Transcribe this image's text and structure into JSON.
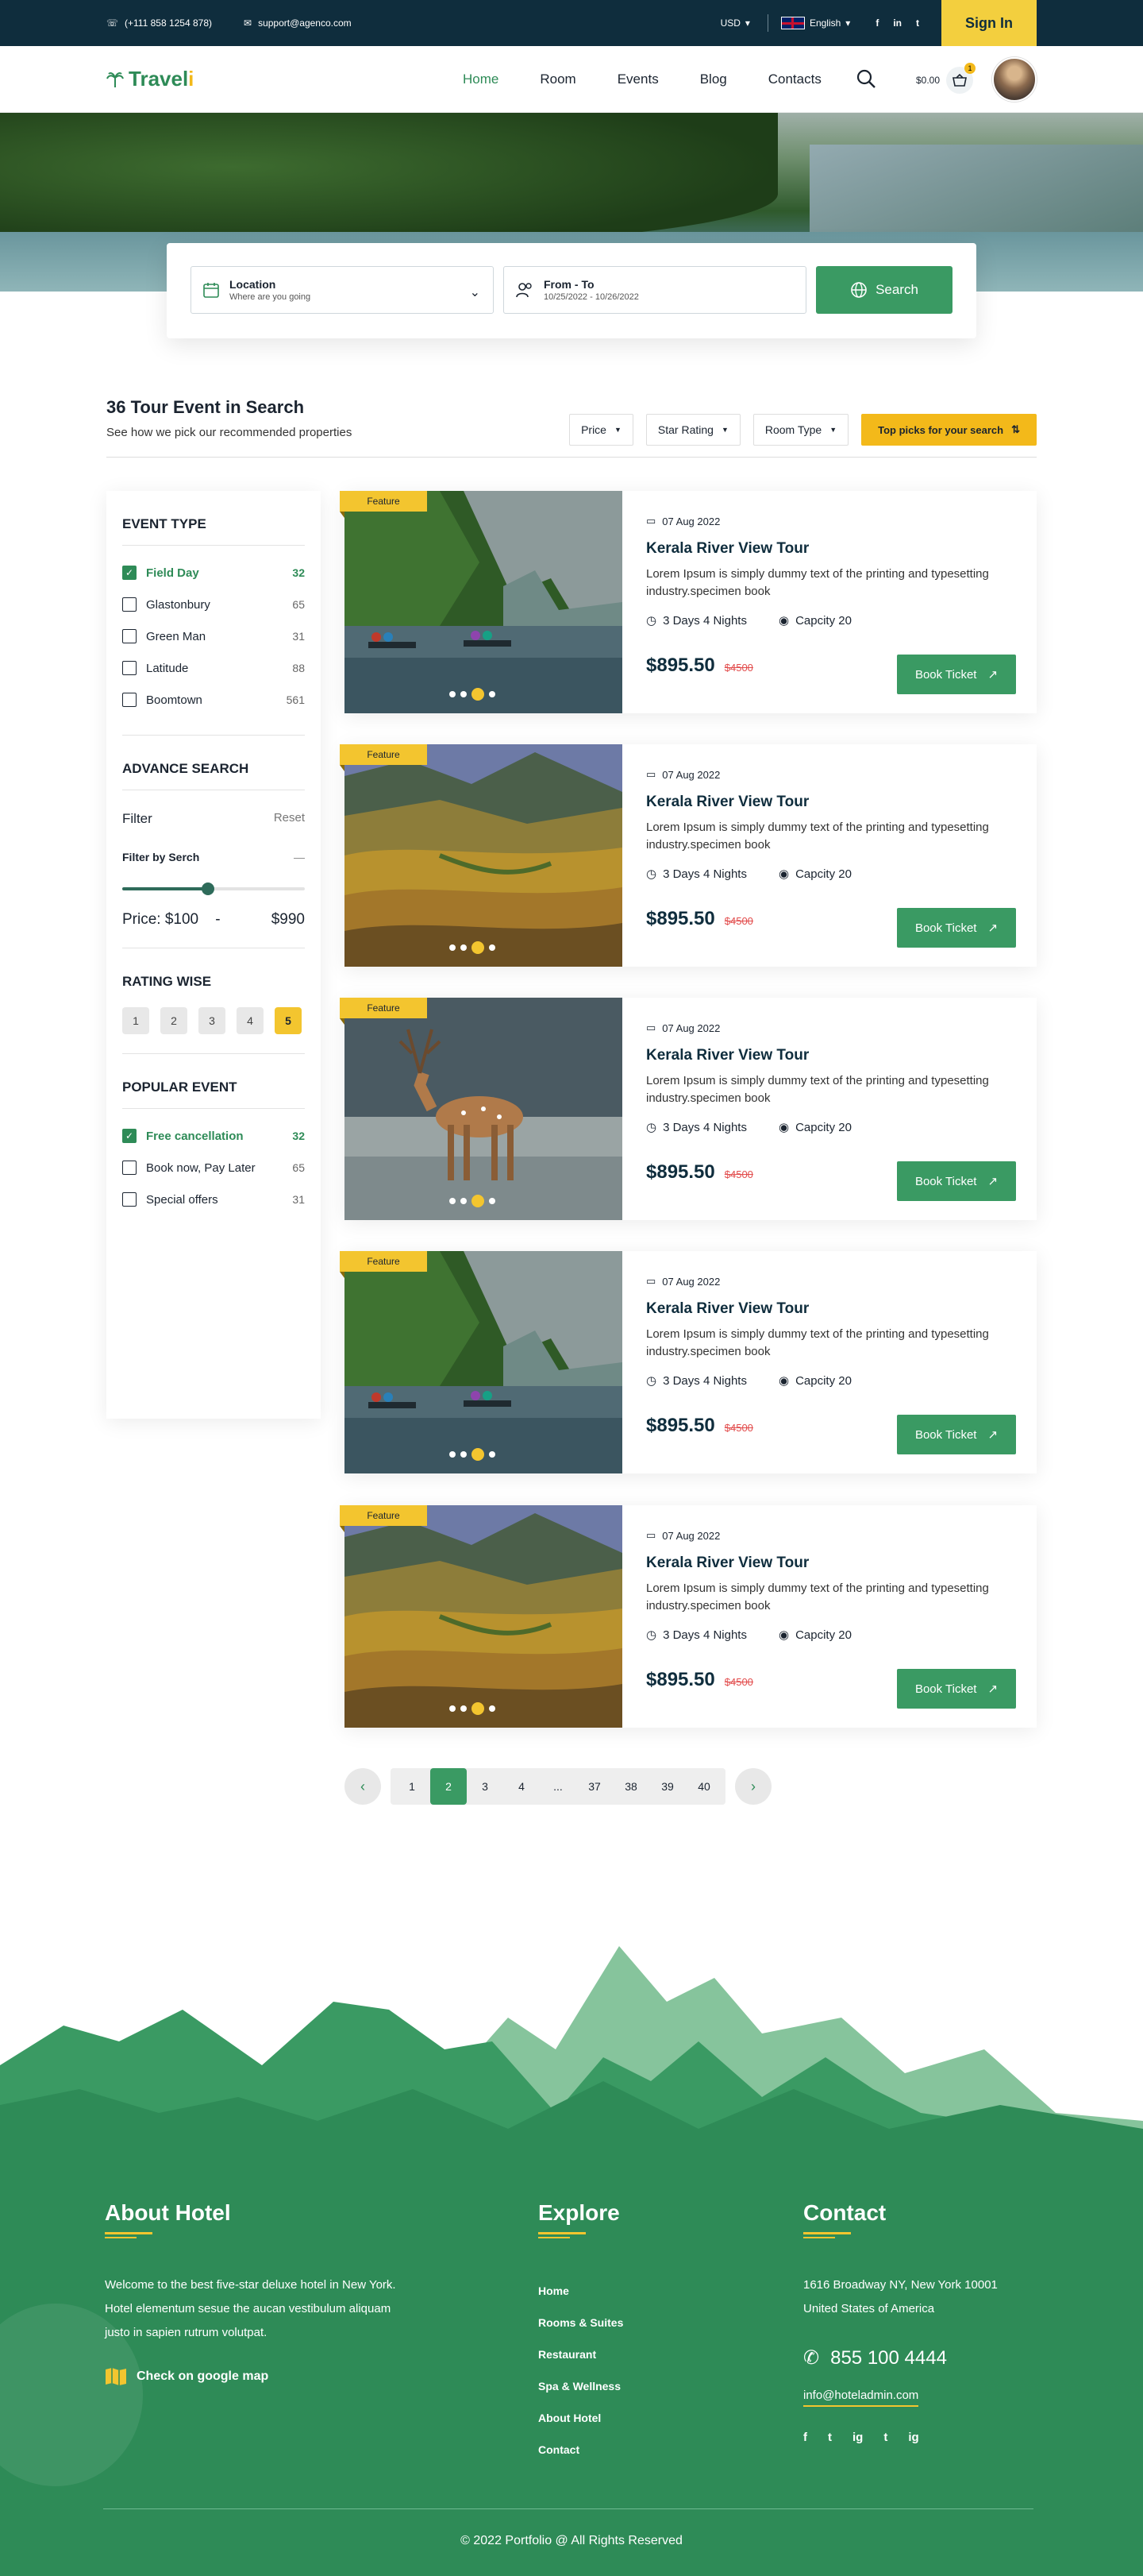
{
  "topbar": {
    "phone": "(+111 858 1254 878)",
    "email": "support@agenco.com",
    "currency": "USD",
    "language": "English",
    "social": [
      "f",
      "in",
      "t"
    ],
    "signin_label": "Sign In"
  },
  "nav": {
    "logo": "Travel",
    "logo_accent": "i",
    "items": [
      {
        "label": "Home"
      },
      {
        "label": "Room"
      },
      {
        "label": "Events"
      },
      {
        "label": "Blog"
      },
      {
        "label": "Contacts"
      }
    ],
    "cart_total": "$0.00",
    "cart_count": "1"
  },
  "search": {
    "location_label": "Location",
    "location_hint": "Where are you going",
    "dates_label": "From - To",
    "dates_value": "10/25/2022 - 10/26/2022",
    "button_label": "Search"
  },
  "results": {
    "title": "36 Tour Event in Search",
    "subtitle": "See how we pick our recommended properties",
    "filters": [
      "Price",
      "Star Rating",
      "Room Type"
    ],
    "top_picks": "Top picks for your search"
  },
  "sidebar": {
    "event_type_title": "EVENT TYPE",
    "event_types": [
      {
        "label": "Field Day",
        "count": "32",
        "checked": true
      },
      {
        "label": "Glastonbury",
        "count": "65",
        "checked": false
      },
      {
        "label": "Green Man",
        "count": "31",
        "checked": false
      },
      {
        "label": "Latitude",
        "count": "88",
        "checked": false
      },
      {
        "label": "Boomtown",
        "count": "561",
        "checked": false
      }
    ],
    "advance_title": "ADVANCE SEARCH",
    "filter_label": "Filter",
    "reset_label": "Reset",
    "filter_by": "Filter by Serch",
    "price_min": "Price: $100",
    "price_sep": "-",
    "price_max": "$990",
    "slider_fraction": 0.47,
    "rating_title": "RATING WISE",
    "ratings": [
      "1",
      "2",
      "3",
      "4",
      "5"
    ],
    "rating_selected": "5",
    "popular_title": "POPULAR EVENT",
    "popular": [
      {
        "label": "Free cancellation",
        "count": "32",
        "checked": true
      },
      {
        "label": "Book now, Pay Later",
        "count": "65",
        "checked": false
      },
      {
        "label": "Special offers",
        "count": "31",
        "checked": false
      }
    ]
  },
  "cards": [
    {
      "tag": "Feature",
      "date": "07 Aug 2022",
      "title": "Kerala River View Tour",
      "desc": "Lorem Ipsum is simply dummy text of the printing and typesetting industry.specimen book",
      "duration": "3 Days 4 Nights",
      "capacity": "Capcity 20",
      "price": "$895.50",
      "old_price": "$4500",
      "book": "Book Ticket",
      "image": "river"
    },
    {
      "tag": "Feature",
      "date": "07 Aug 2022",
      "title": "Kerala River View Tour",
      "desc": "Lorem Ipsum is simply dummy text of the printing and typesetting industry.specimen book",
      "duration": "3 Days 4 Nights",
      "capacity": "Capcity 20",
      "price": "$895.50",
      "old_price": "$4500",
      "book": "Book Ticket",
      "image": "terraces"
    },
    {
      "tag": "Feature",
      "date": "07 Aug 2022",
      "title": "Kerala River View Tour",
      "desc": "Lorem Ipsum is simply dummy text of the printing and typesetting industry.specimen book",
      "duration": "3 Days 4 Nights",
      "capacity": "Capcity 20",
      "price": "$895.50",
      "old_price": "$4500",
      "book": "Book Ticket",
      "image": "deer"
    },
    {
      "tag": "Feature",
      "date": "07 Aug 2022",
      "title": "Kerala River View Tour",
      "desc": "Lorem Ipsum is simply dummy text of the printing and typesetting industry.specimen book",
      "duration": "3 Days 4 Nights",
      "capacity": "Capcity 20",
      "price": "$895.50",
      "old_price": "$4500",
      "book": "Book Ticket",
      "image": "river"
    },
    {
      "tag": "Feature",
      "date": "07 Aug 2022",
      "title": "Kerala River View Tour",
      "desc": "Lorem Ipsum is simply dummy text of the printing and typesetting industry.specimen book",
      "duration": "3 Days 4 Nights",
      "capacity": "Capcity 20",
      "price": "$895.50",
      "old_price": "$4500",
      "book": "Book Ticket",
      "image": "terraces"
    }
  ],
  "pagination": {
    "pages": [
      "1",
      "2",
      "3",
      "4",
      "...",
      "37",
      "38",
      "39",
      "40"
    ],
    "current": "2"
  },
  "footer": {
    "about_title": "About Hotel",
    "about_text": "Welcome to the best five-star deluxe hotel in New York. Hotel elementum sesue the aucan vestibulum aliquam justo in sapien rutrum volutpat.",
    "map_link": "Check on google map",
    "explore_title": "Explore",
    "explore_links": [
      "Home",
      "Rooms & Suites",
      "Restaurant",
      "Spa & Wellness",
      "About Hotel",
      "Contact"
    ],
    "contact_title": "Contact",
    "address": "1616 Broadway NY, New York 10001 United States of America",
    "phone": "855 100 4444",
    "email": "info@hoteladmin.com",
    "social": [
      "f",
      "t",
      "ig",
      "t",
      "ig"
    ],
    "copyright": "© 2022 Portfolio @ All Rights Reserved"
  },
  "colors": {
    "primary": "#3a9a63",
    "accent": "#f3c52f",
    "dark": "#0f2d3d"
  }
}
